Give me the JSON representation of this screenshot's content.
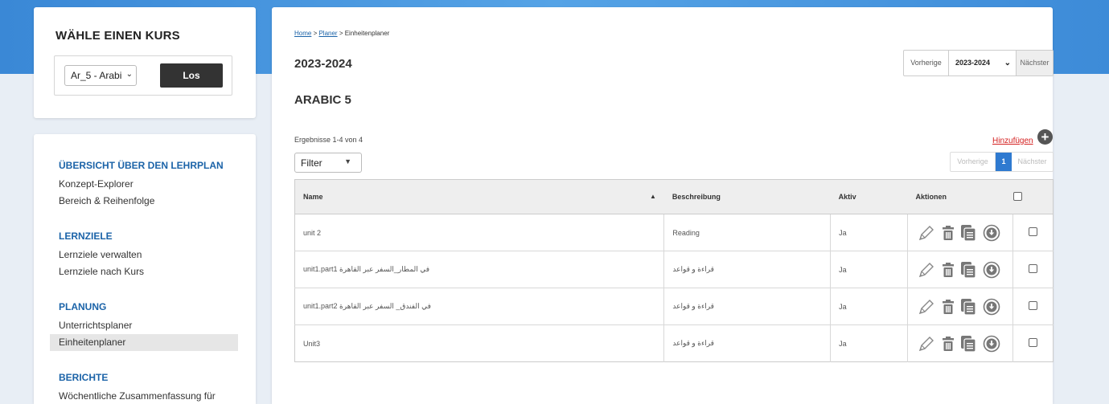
{
  "course_picker": {
    "title": "WÄHLE EINEN KURS",
    "selected_course": "Ar_5 - Arabi",
    "go_label": "Los"
  },
  "nav": {
    "sections": [
      {
        "heading": "ÜBERSICHT ÜBER DEN LEHRPLAN",
        "items": [
          "Konzept-Explorer",
          "Bereich & Reihenfolge"
        ]
      },
      {
        "heading": "LERNZIELE",
        "items": [
          "Lernziele verwalten",
          "Lernziele nach Kurs"
        ]
      },
      {
        "heading": "PLANUNG",
        "items": [
          "Unterrichtsplaner",
          "Einheitenplaner"
        ]
      },
      {
        "heading": "BERICHTE",
        "items": [
          "Wöchentliche Zusammenfassung für"
        ]
      }
    ],
    "active_item": "Einheitenplaner"
  },
  "breadcrumb": {
    "home": "Home",
    "sep1": " > ",
    "planer": "Planer",
    "sep2": " > ",
    "current": "Einheitenplaner"
  },
  "page": {
    "year_title": "2023-2024",
    "course_heading": "ARABIC 5",
    "results_text": "Ergebnisse 1-4 von 4",
    "add_label": "Hinzufügen",
    "filter_label": "Filter"
  },
  "year_pager": {
    "prev": "Vorherige",
    "selected_year": "2023-2024",
    "next": "Nächster"
  },
  "page_pager": {
    "prev": "Vorherige",
    "current": "1",
    "next": "Nächster"
  },
  "table": {
    "headers": {
      "name": "Name",
      "description": "Beschreibung",
      "active": "Aktiv",
      "actions": "Aktionen"
    },
    "rows": [
      {
        "name": "unit 2",
        "description": "Reading",
        "active": "Ja"
      },
      {
        "name": "unit1.part1 في المطار_السفر عبر القاهرة",
        "description": "قراءة و قواعد",
        "active": "Ja"
      },
      {
        "name": "unit1.part2 في الفندق_ السفر عبر القاهرة",
        "description": "قراءة و قواعد",
        "active": "Ja"
      },
      {
        "name": "Unit3",
        "description": "قراءة و قواعد",
        "active": "Ja"
      }
    ]
  },
  "icons": {
    "edit": "pencil-icon",
    "delete": "trash-icon",
    "copy": "copy-icon",
    "download": "download-icon",
    "add": "plus-circle-icon",
    "sort": "sort-up-icon"
  },
  "colors": {
    "header_blue": "#3f8fd8",
    "link_blue": "#1b63a8",
    "add_red": "#d42020",
    "active_page": "#2f7ad0"
  }
}
